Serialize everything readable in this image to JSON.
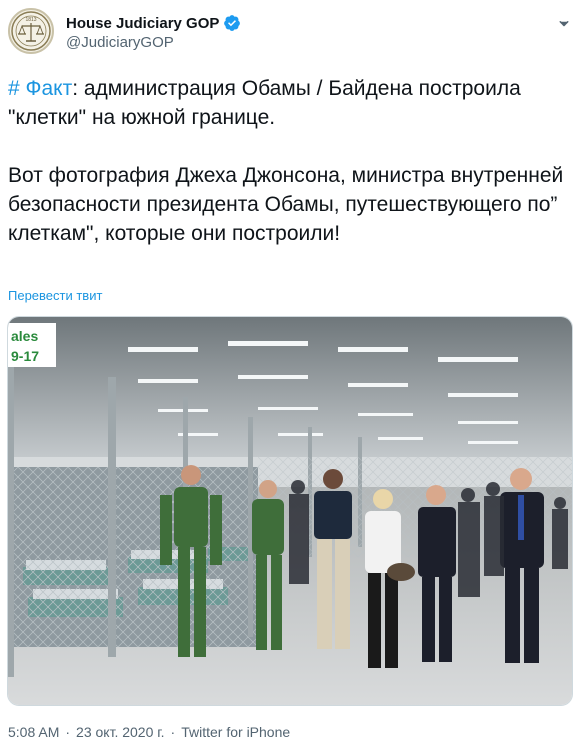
{
  "account": {
    "display_name": "House Judiciary GOP",
    "handle": "@JudiciaryGOP",
    "avatar_icon": "scales-of-justice-seal-icon",
    "avatar_year": "1813",
    "verified_icon": "verified-badge-icon",
    "more_icon": "more-options-icon"
  },
  "tweet": {
    "hashtag": "# Факт",
    "line1_rest": ": администрация Обамы / Байдена построила \"клетки\" на южной границе.",
    "paragraph2": "Вот фотография Джеха Джонсона, министра внутренней безопасности президента Обамы, путешествующего по” клеткам\", которые они построили!",
    "translate_label": "Перевести твит"
  },
  "photo": {
    "description_icon": "detention-facility-photo",
    "sign_text_top": "ales",
    "sign_text_bottom": "9-17"
  },
  "meta": {
    "time": "5:08 AM",
    "separator": "·",
    "date": "23 окт. 2020 г.",
    "app": "Twitter for iPhone"
  },
  "colors": {
    "link": "#1b95e0",
    "verified": "#1d9bf0",
    "secondary_text": "#536471"
  }
}
